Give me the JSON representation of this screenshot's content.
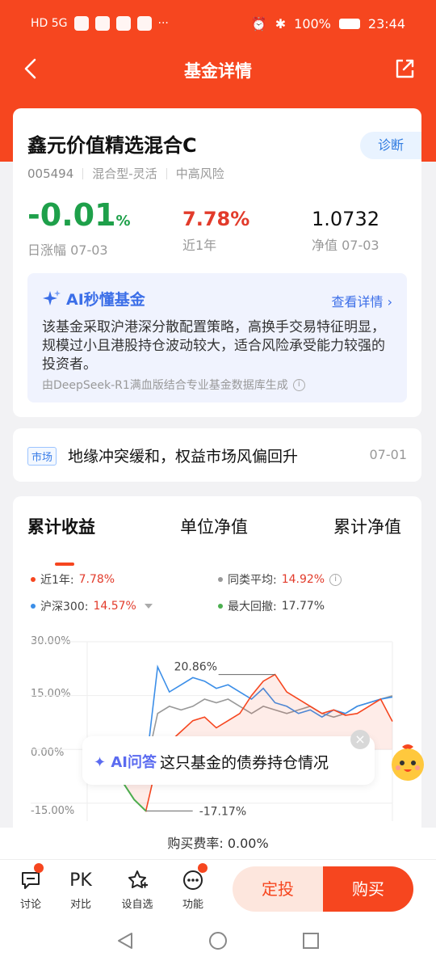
{
  "status_bar": {
    "left": "HD 5G",
    "battery": "100%",
    "time": "23:44"
  },
  "nav": {
    "title": "基金详情"
  },
  "fund": {
    "name": "鑫元价值精选混合C",
    "diagnose": "诊断",
    "code": "005494",
    "type": "混合型-灵活",
    "risk": "中高风险",
    "day_change": "-0.01",
    "day_change_unit": "%",
    "day_change_label": "日涨幅 07-03",
    "year_return": "7.78%",
    "year_return_label": "近1年",
    "nav_value": "1.0732",
    "nav_label": "净值 07-03"
  },
  "ai_summary": {
    "title": "AI秒懂基金",
    "more": "查看详情",
    "text": "该基金采取沪港深分散配置策略，高换手交易特征明显，规模过小且港股持仓波动较大，适合风险承受能力较强的投资者。",
    "source": "由DeepSeek-R1满血版结合专业基金数据库生成"
  },
  "news": {
    "tag": "市场",
    "text": "地缘冲突缓和，权益市场风偏回升",
    "date": "07-01"
  },
  "chart_tabs": [
    "累计收益",
    "单位净值",
    "累计净值"
  ],
  "legend": [
    {
      "label": "近1年:",
      "value": "7.78%",
      "color": "#f6461f"
    },
    {
      "label": "同类平均:",
      "value": "14.92%",
      "color": "#999999"
    },
    {
      "label": "沪深300:",
      "value": "14.57%",
      "color": "#3b8ee8"
    },
    {
      "label": "最大回撤:",
      "value": "17.77%",
      "color": "#4caf50"
    }
  ],
  "chart_data": {
    "type": "line",
    "ylim": [
      -20,
      30
    ],
    "ytick_labels": [
      "30.00%",
      "15.00%",
      "0.00%",
      "-15.00%"
    ],
    "annotations": [
      "20.86%",
      "-17.17%"
    ],
    "series": [
      {
        "name": "近1年",
        "color": "#f6461f",
        "values": [
          0,
          -2,
          -5,
          -9,
          -14,
          -17.17,
          -3,
          2,
          5,
          8,
          9,
          6,
          8,
          10,
          15,
          19,
          20.86,
          16,
          14,
          12,
          10,
          11,
          9.5,
          10,
          12,
          14,
          7.78
        ]
      },
      {
        "name": "同类平均",
        "color": "#999999",
        "values": [
          0,
          -1,
          -2,
          -3,
          -4,
          -5,
          10,
          12,
          11,
          12,
          14,
          13,
          14,
          12,
          10,
          12,
          11,
          10,
          11,
          12,
          10,
          9,
          10,
          12,
          13,
          14,
          14.92
        ]
      },
      {
        "name": "沪深300",
        "color": "#3b8ee8",
        "values": [
          0,
          -1,
          -2,
          -3,
          -4,
          -5,
          23,
          16,
          18,
          20,
          19,
          17,
          18,
          16,
          14,
          17,
          13,
          12,
          10,
          11,
          9,
          11,
          10,
          12,
          13,
          14,
          14.57
        ]
      }
    ]
  },
  "ask": {
    "label": "AI问答",
    "question": "这只基金的债券持仓情况"
  },
  "fee": "购买费率: 0.00%",
  "bottom": {
    "discuss": "讨论",
    "pk": "PK",
    "compare": "对比",
    "watch": "设自选",
    "func": "功能",
    "auto_invest": "定投",
    "buy": "购买"
  }
}
